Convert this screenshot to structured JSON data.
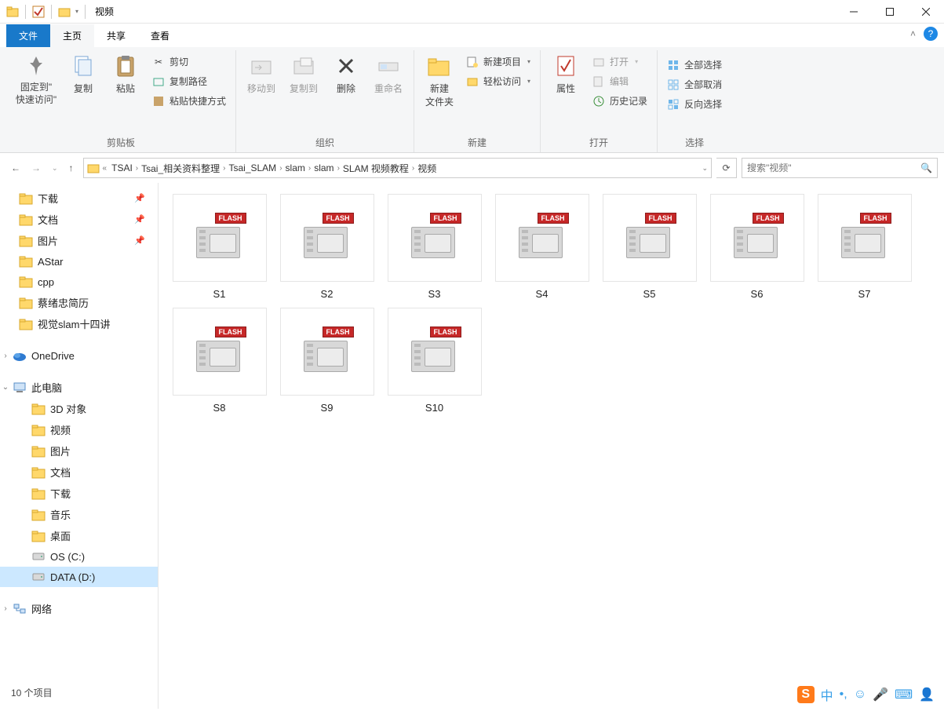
{
  "window": {
    "title": "视频"
  },
  "tabs": {
    "file": "文件",
    "home": "主页",
    "share": "共享",
    "view": "查看"
  },
  "ribbon": {
    "clipboard": {
      "label": "剪贴板",
      "pin": "固定到\"\n快速访问\"",
      "copy": "复制",
      "paste": "粘贴",
      "cut": "剪切",
      "copypath": "复制路径",
      "pasteshortcut": "粘贴快捷方式"
    },
    "organize": {
      "label": "组织",
      "moveto": "移动到",
      "copyto": "复制到",
      "delete": "删除",
      "rename": "重命名"
    },
    "new": {
      "label": "新建",
      "newfolder": "新建\n文件夹",
      "newitem": "新建项目",
      "easyaccess": "轻松访问"
    },
    "open": {
      "label": "打开",
      "properties": "属性",
      "open": "打开",
      "edit": "编辑",
      "history": "历史记录"
    },
    "select": {
      "label": "选择",
      "selectall": "全部选择",
      "selectnone": "全部取消",
      "invert": "反向选择"
    }
  },
  "breadcrumbs": [
    "TSAI",
    "Tsai_相关资料整理",
    "Tsai_SLAM",
    "slam",
    "slam",
    "SLAM 视频教程",
    "视频"
  ],
  "search_placeholder": "搜索\"视频\"",
  "nav": {
    "quick": [
      {
        "label": "下载",
        "pin": true
      },
      {
        "label": "文档",
        "pin": true
      },
      {
        "label": "图片",
        "pin": true
      },
      {
        "label": "AStar",
        "pin": false
      },
      {
        "label": "cpp",
        "pin": false
      },
      {
        "label": "蔡绪忠简历",
        "pin": false
      },
      {
        "label": "视觉slam十四讲",
        "pin": false
      }
    ],
    "onedrive": "OneDrive",
    "thispc": {
      "label": "此电脑",
      "children": [
        "3D 对象",
        "视频",
        "图片",
        "文档",
        "下载",
        "音乐",
        "桌面",
        "OS (C:)",
        "DATA (D:)"
      ]
    },
    "network": "网络"
  },
  "files": [
    "S1",
    "S2",
    "S3",
    "S4",
    "S5",
    "S6",
    "S7",
    "S8",
    "S9",
    "S10"
  ],
  "status": "10 个项目",
  "ime_lang": "中"
}
